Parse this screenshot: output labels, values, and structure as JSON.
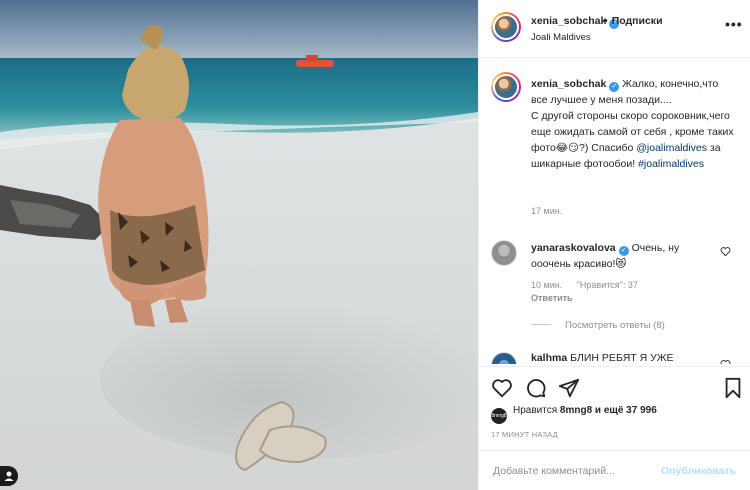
{
  "post": {
    "username": "xenia_sobchak",
    "follow_label": "Подписки",
    "dot": "•",
    "location": "Joali Maldives",
    "more": "•••"
  },
  "caption": {
    "username": "xenia_sobchak",
    "text_1": "Жалко, конечно,что все лучшее у меня позади....",
    "text_2": "С другой стороны скоро сороковник,чего еще ожидать самой от себя , кроме таких фото😂😏?) Спасибо ",
    "mention": "@joalimaldives",
    "text_3": " за шикарные фотообои! ",
    "hashtag": "#joalimaldives",
    "time": "17 мин."
  },
  "comment": {
    "username": "yanaraskovalova",
    "text": " Очень, ну ооочень красиво!😻",
    "time": "10 мин.",
    "likes": "\"Нравится\": 37",
    "reply": "Ответить",
    "view_replies": "Посмотреть ответы (8)"
  },
  "comment2": {
    "username": "kalhma",
    "text": " БЛИН РЕБЯТ Я УЖЕ"
  },
  "likes": {
    "avatar_text": "8mng8",
    "prefix": "Нравится ",
    "user": "8mng8",
    "suffix": " и ещё 37 996"
  },
  "timestamp": "17 МИНУТ НАЗАД",
  "add_comment": {
    "placeholder": "Добавьте комментарий...",
    "post_label": "Опубликовать"
  },
  "colors": {
    "link": "#00376b",
    "verified": "#3897f0",
    "post_button_disabled": "#b2dffc",
    "muted": "#8e8e8e"
  },
  "icons": [
    "heart-icon",
    "comment-icon",
    "share-icon",
    "bookmark-icon",
    "more-icon",
    "verified-icon",
    "user-tag-icon"
  ]
}
